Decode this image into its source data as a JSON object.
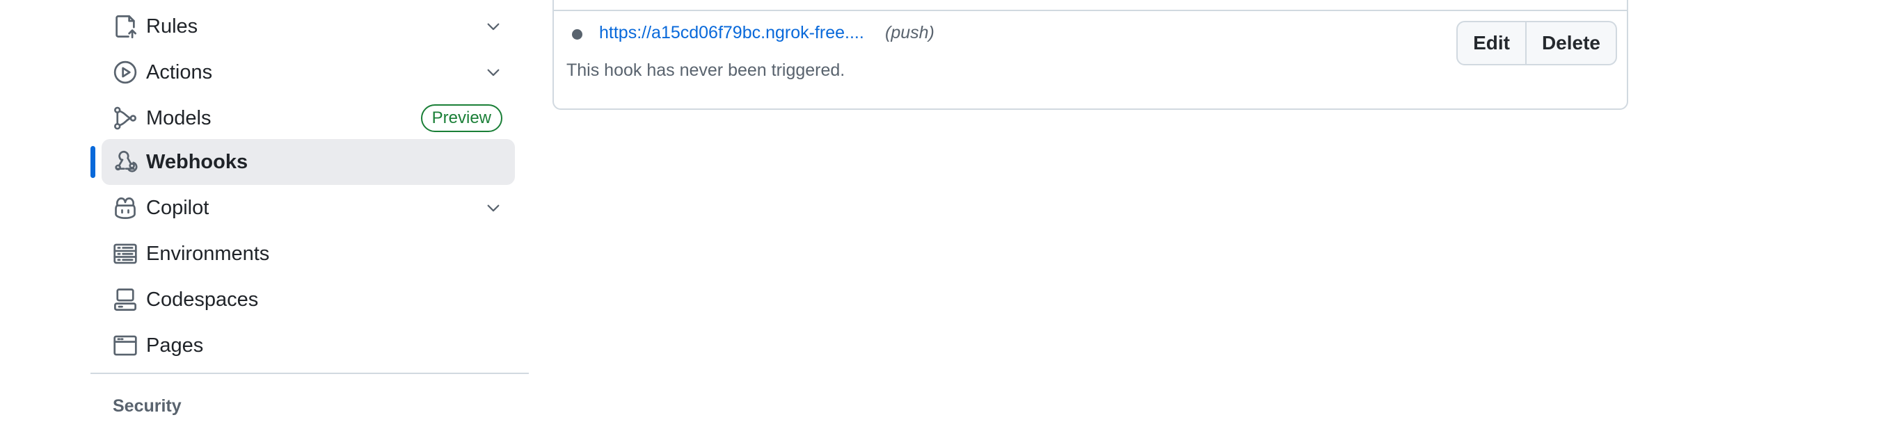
{
  "sidebar": {
    "items": [
      {
        "label": "Rules",
        "icon": "rules-icon",
        "expandable": true
      },
      {
        "label": "Actions",
        "icon": "play-icon",
        "expandable": true
      },
      {
        "label": "Models",
        "icon": "models-icon",
        "badge": "Preview"
      },
      {
        "label": "Webhooks",
        "icon": "webhook-icon",
        "active": true
      },
      {
        "label": "Copilot",
        "icon": "copilot-icon",
        "expandable": true
      },
      {
        "label": "Environments",
        "icon": "server-icon"
      },
      {
        "label": "Codespaces",
        "icon": "codespaces-icon"
      },
      {
        "label": "Pages",
        "icon": "browser-icon"
      }
    ],
    "section_heading": "Security"
  },
  "webhook": {
    "url": "https://a15cd06f79bc.ngrok-free....",
    "events": "(push)",
    "status_text": "This hook has never been triggered.",
    "edit_label": "Edit",
    "delete_label": "Delete"
  },
  "colors": {
    "accent": "#0969da",
    "success": "#1a7f37",
    "active_bg": "#eaebee",
    "muted_text": "#59636e",
    "border": "#d1d9e0"
  }
}
